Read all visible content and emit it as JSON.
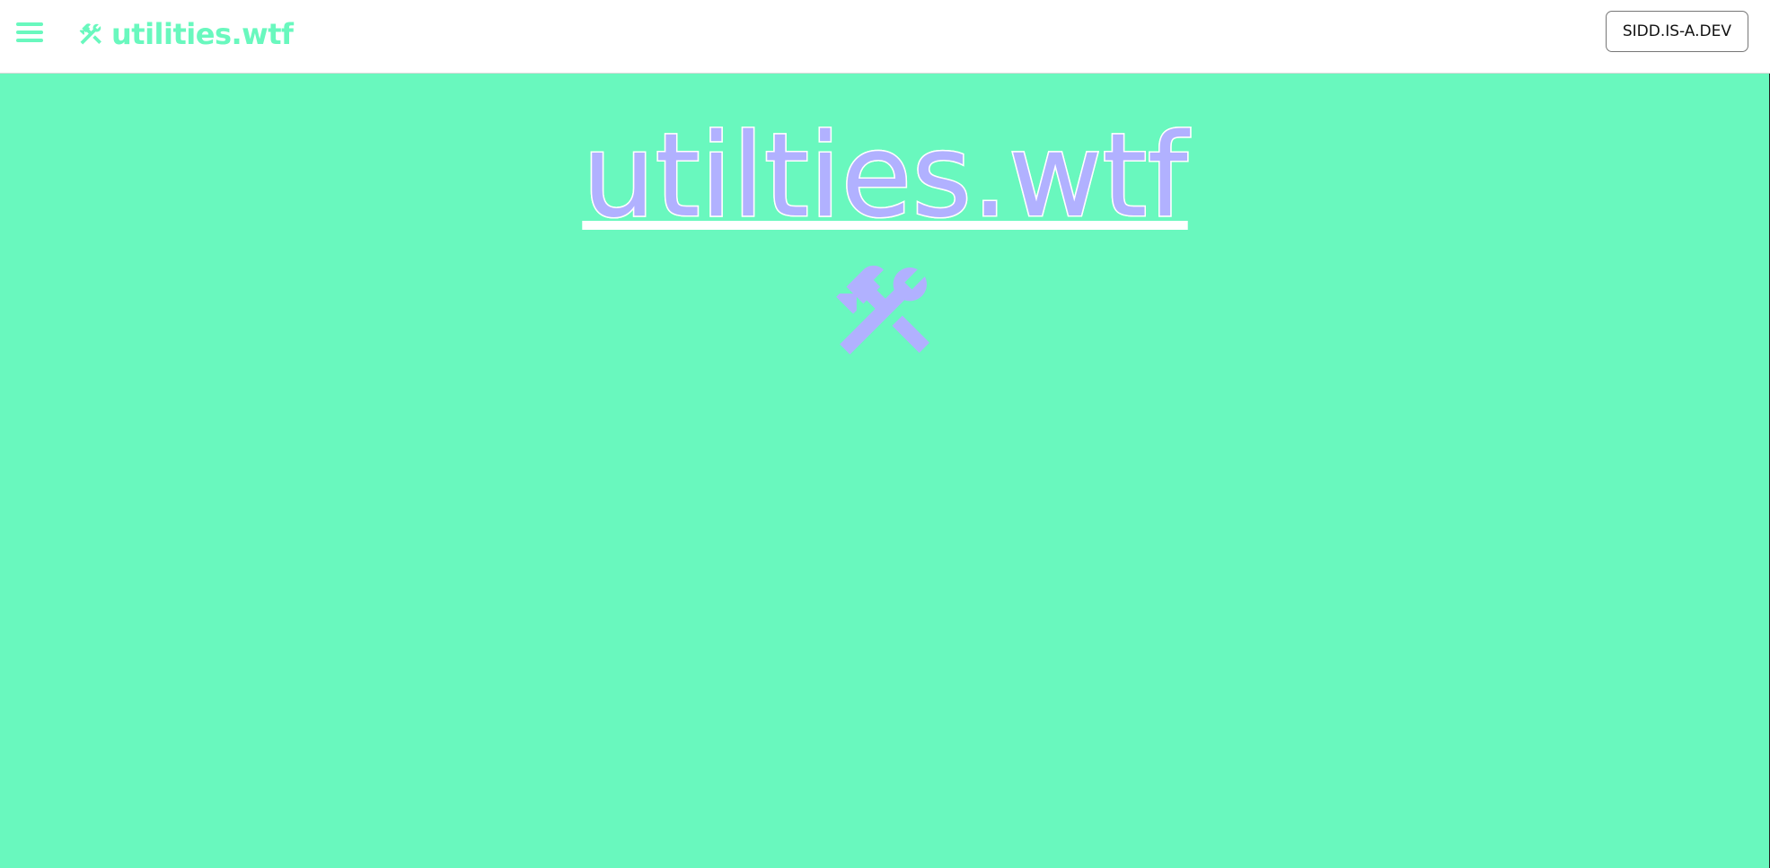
{
  "header": {
    "menu_icon": "hamburger-icon",
    "brand_icon": "tools-icon",
    "brand_text": "utilities.wtf",
    "user_button_label": "SIDD.IS-A.DEV"
  },
  "hero": {
    "title": "utilties.wtf",
    "icon": "tools-icon"
  },
  "colors": {
    "accent": "#69f8be",
    "hero_text": "#b1b1ff",
    "background": "#69f8be",
    "header_bg": "#ffffff"
  }
}
